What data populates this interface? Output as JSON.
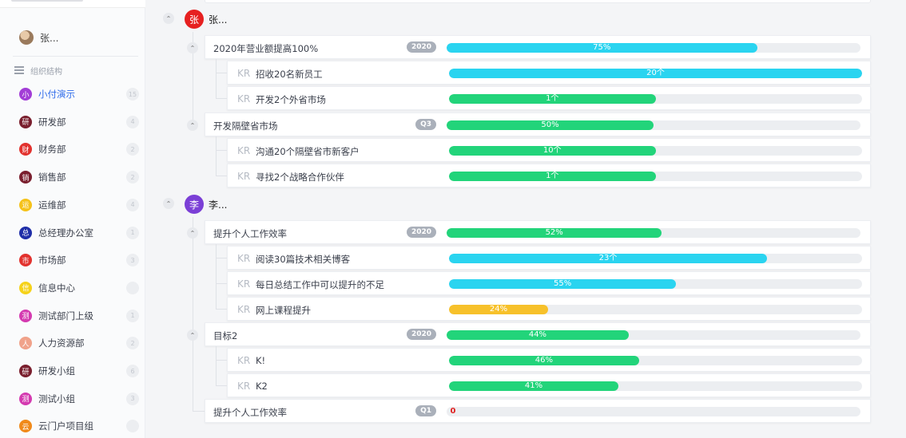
{
  "sidebar": {
    "user_name": "张...",
    "section_title": "组织结构",
    "departments": [
      {
        "abbr": "小",
        "label": "小付演示",
        "count": "15",
        "color": "#a23dd6",
        "active": true
      },
      {
        "abbr": "研",
        "label": "研发部",
        "count": "4",
        "color": "#7a1f2e"
      },
      {
        "abbr": "财",
        "label": "财务部",
        "count": "2",
        "color": "#e2322e"
      },
      {
        "abbr": "销",
        "label": "销售部",
        "count": "2",
        "color": "#7a1f2e"
      },
      {
        "abbr": "运",
        "label": "运维部",
        "count": "4",
        "color": "#f5c21a"
      },
      {
        "abbr": "总",
        "label": "总经理办公室",
        "count": "1",
        "color": "#1f2ea8"
      },
      {
        "abbr": "市",
        "label": "市场部",
        "count": "3",
        "color": "#e2322e"
      },
      {
        "abbr": "信",
        "label": "信息中心",
        "count": "",
        "color": "#f5d21a"
      },
      {
        "abbr": "测",
        "label": "测试部门上级",
        "count": "1",
        "color": "#d43ab0"
      },
      {
        "abbr": "人",
        "label": "人力资源部",
        "count": "2",
        "color": "#f0a28a"
      },
      {
        "abbr": "研",
        "label": "研发小组",
        "count": "6",
        "color": "#7a1f2e"
      },
      {
        "abbr": "测",
        "label": "测试小组",
        "count": "3",
        "color": "#d43ab0"
      },
      {
        "abbr": "云",
        "label": "云门户项目组",
        "count": "",
        "color": "#f08a1a"
      }
    ]
  },
  "owners": [
    {
      "abbr": "张",
      "name": "张...",
      "color": "#e62020"
    },
    {
      "abbr": "李",
      "name": "李...",
      "color": "#7b3fd6"
    }
  ],
  "objectives": [
    {
      "title": "2020年营业额提高100%",
      "tag": "2020",
      "progress": 0.75,
      "label": "75%",
      "color": "#2ad4f0",
      "krs": [
        {
          "kr": "KR",
          "title": "招收20名新员工",
          "progress": 1.0,
          "label": "20个",
          "color": "#2ad4f0"
        },
        {
          "kr": "KR",
          "title": "开发2个外省市场",
          "progress": 0.5,
          "label": "1个",
          "color": "#22d47a"
        }
      ]
    },
    {
      "title": "开发隔壁省市场",
      "tag": "Q3",
      "progress": 0.5,
      "label": "50%",
      "color": "#22d47a",
      "krs": [
        {
          "kr": "KR",
          "title": "沟通20个隔壁省市新客户",
          "progress": 0.5,
          "label": "10个",
          "color": "#22d47a"
        },
        {
          "kr": "KR",
          "title": "寻找2个战略合作伙伴",
          "progress": 0.5,
          "label": "1个",
          "color": "#22d47a"
        }
      ]
    },
    {
      "title": "提升个人工作效率",
      "tag": "2020",
      "progress": 0.52,
      "label": "52%",
      "color": "#22d47a",
      "krs": [
        {
          "kr": "KR",
          "title": "阅读30篇技术相关博客",
          "progress": 0.77,
          "label": "23个",
          "color": "#2ad4f0"
        },
        {
          "kr": "KR",
          "title": "每日总结工作中可以提升的不足",
          "progress": 0.55,
          "label": "55%",
          "color": "#2ad4f0"
        },
        {
          "kr": "KR",
          "title": "网上课程提升",
          "progress": 0.24,
          "label": "24%",
          "color": "#f7c12a"
        }
      ]
    },
    {
      "title": "目标2",
      "tag": "2020",
      "progress": 0.44,
      "label": "44%",
      "color": "#22d47a",
      "krs": [
        {
          "kr": "KR",
          "title": "K!",
          "progress": 0.46,
          "label": "46%",
          "color": "#22d47a"
        },
        {
          "kr": "KR",
          "title": "K2",
          "progress": 0.41,
          "label": "41%",
          "color": "#22d47a"
        }
      ]
    },
    {
      "title": "提升个人工作效率",
      "tag": "Q1",
      "progress": 0.0,
      "label": "0",
      "color": "#e02020",
      "krs": []
    }
  ]
}
